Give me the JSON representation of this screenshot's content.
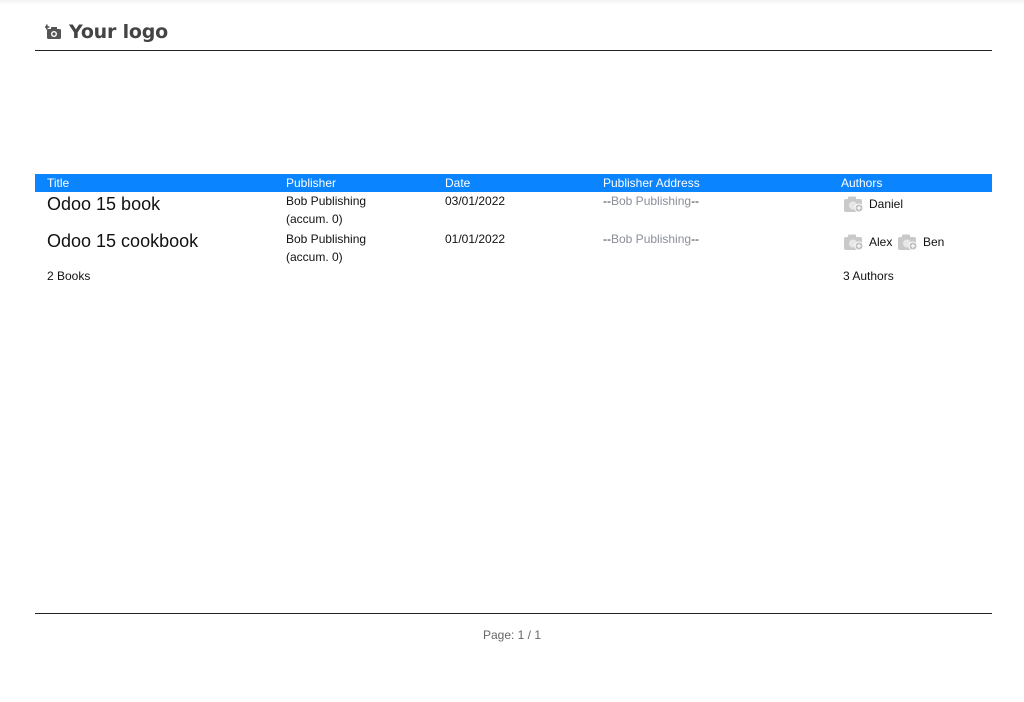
{
  "header": {
    "logo_text": "Your logo"
  },
  "table": {
    "columns": [
      "Title",
      "Publisher",
      "Date",
      "Publisher Address",
      "Authors"
    ],
    "rows": [
      {
        "title": "Odoo 15 book",
        "publisher": "Bob Publishing",
        "accum": "(accum. 0)",
        "date": "03/01/2022",
        "address_prefix": "--",
        "address_name": "Bob Publishing",
        "address_suffix": "--",
        "authors": [
          "Daniel"
        ]
      },
      {
        "title": "Odoo 15 cookbook",
        "publisher": "Bob Publishing",
        "accum": "(accum. 0)",
        "date": "01/01/2022",
        "address_prefix": "--",
        "address_name": "Bob Publishing",
        "address_suffix": "--",
        "authors": [
          "Alex",
          "Ben"
        ]
      }
    ],
    "summary": {
      "books": "2 Books",
      "authors": "3 Authors"
    }
  },
  "footer": {
    "page": "Page: 1 / 1"
  },
  "colors": {
    "header_bg": "#0a84ff",
    "muted": "#8a8f99"
  },
  "icons": {
    "logo": "camera-icon",
    "avatar": "camera-placeholder-icon"
  }
}
